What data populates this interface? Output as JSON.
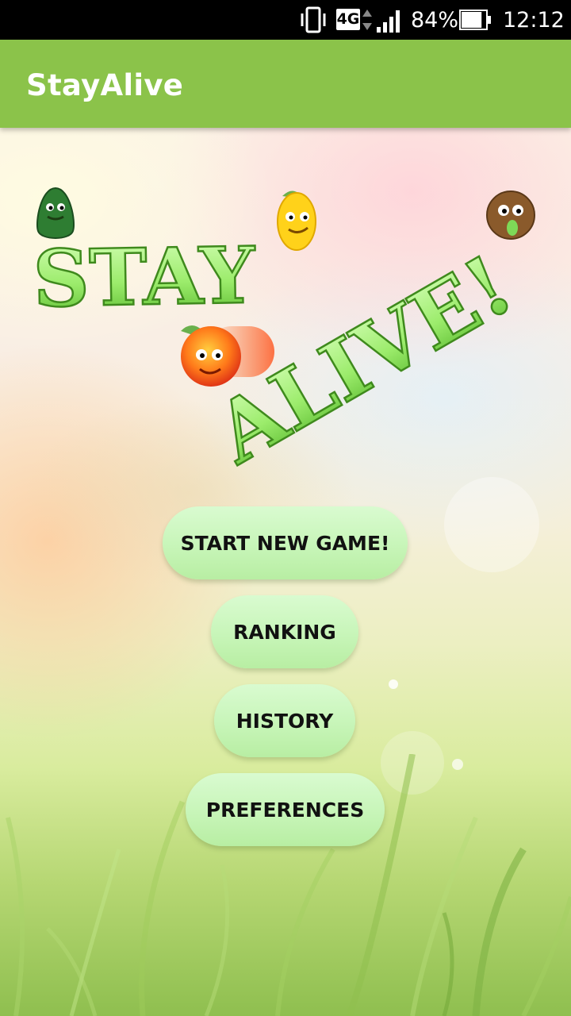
{
  "status_bar": {
    "network": "4G",
    "battery_percent": "84%",
    "battery_level": 0.84,
    "time": "12:12",
    "icons": [
      "vibrate-icon",
      "network-4g-icon",
      "signal-icon",
      "battery-icon"
    ]
  },
  "app_bar": {
    "title": "StayAlive",
    "color": "#8bc34a"
  },
  "logo": {
    "line1": "STAY",
    "line2": "ALIVE!",
    "text_color": "#7ed957",
    "characters": [
      "avocado-character",
      "lemon-character",
      "kiwi-character",
      "flying-apple-character"
    ]
  },
  "menu": {
    "start_new_game": "START NEW GAME!",
    "ranking": "RANKING",
    "history": "HISTORY",
    "preferences": "PREFERENCES",
    "button_color": "#c7f5b8"
  }
}
